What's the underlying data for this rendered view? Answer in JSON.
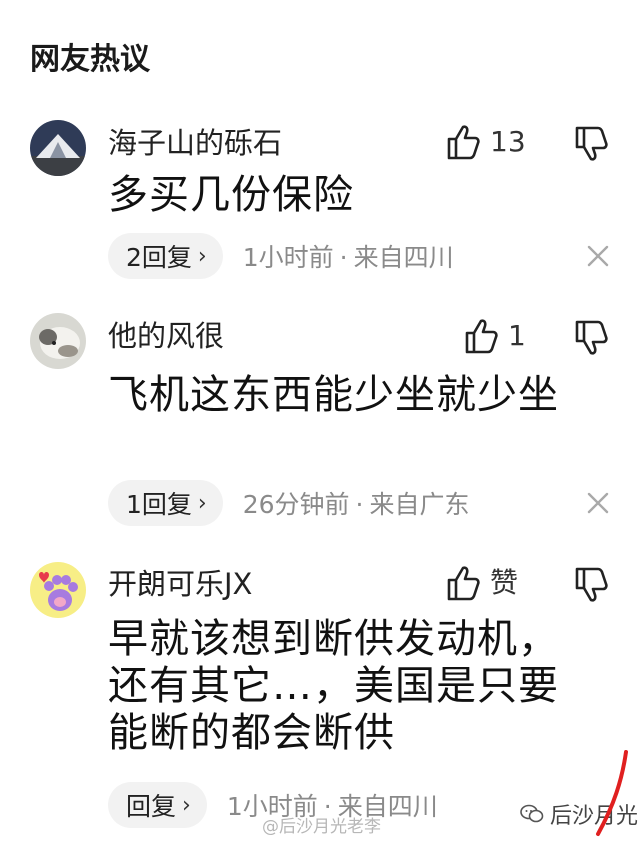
{
  "section": {
    "title": "网友热议"
  },
  "comments": [
    {
      "username": "海子山的砾石",
      "like_count": "13",
      "text": "多买几份保险",
      "reply_label": "2回复",
      "time": "1小时前",
      "location": "来自四川"
    },
    {
      "username": "他的风很",
      "like_count": "1",
      "text": "飞机这东西能少坐就少坐",
      "reply_label": "1回复",
      "time": "26分钟前",
      "location": "来自广东"
    },
    {
      "username": "开朗可乐JX",
      "like_count": "赞",
      "text": "早就该想到断供发动机，还有其它…，美国是只要能断的都会断供",
      "reply_label": "回复",
      "time": "1小时前",
      "location": "来自四川"
    }
  ],
  "meta_separator": "·",
  "reply_chevron": "›",
  "watermarks": {
    "weibo": "@后沙月光老李",
    "channel": "后沙月光"
  },
  "icons": {
    "like": "thumbs-up-icon",
    "dislike": "thumbs-down-icon",
    "close": "close-icon",
    "wechat": "wechat-icon"
  },
  "colors": {
    "meta_gray": "#8a8a8a",
    "pill_bg": "#f2f2f2",
    "red_mark": "#e02020"
  }
}
